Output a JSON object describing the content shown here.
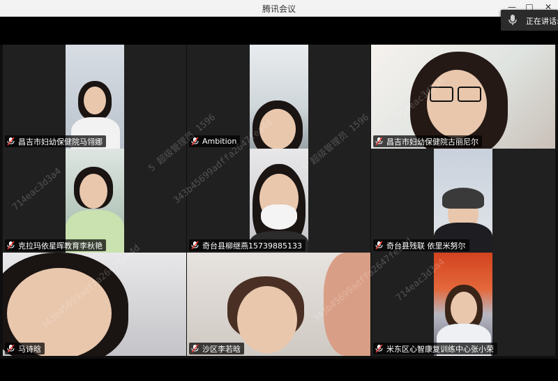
{
  "window": {
    "title": "腾讯会议",
    "controls": {
      "minimize": "—",
      "maximize": "□",
      "close": "✕"
    }
  },
  "speaking_indicator": {
    "text": "正在讲话:",
    "icon": "microphone-icon"
  },
  "participants": [
    {
      "name": "昌吉市妇幼保健院马翎娜"
    },
    {
      "name": "Ambition"
    },
    {
      "name": "昌吉市妇幼保健院古丽尼尔"
    },
    {
      "name": "克拉玛依星晖教育李秋艳"
    },
    {
      "name": "奇台县柳继燕15739885133"
    },
    {
      "name": "奇台县残联 依里米努尔"
    },
    {
      "name": "马诗晗"
    },
    {
      "name": "沙区李若晗"
    },
    {
      "name": "米东区心智康复训练中心张小荣"
    }
  ],
  "watermark": {
    "lines": [
      "714eac3d3a4",
      "5 超级管理员 1596",
      "343b45699adffa2647fea4d"
    ]
  },
  "colors": {
    "label_bg": "#000000",
    "tile_bg": "#202020",
    "app_bg": "#0f0f0f"
  }
}
